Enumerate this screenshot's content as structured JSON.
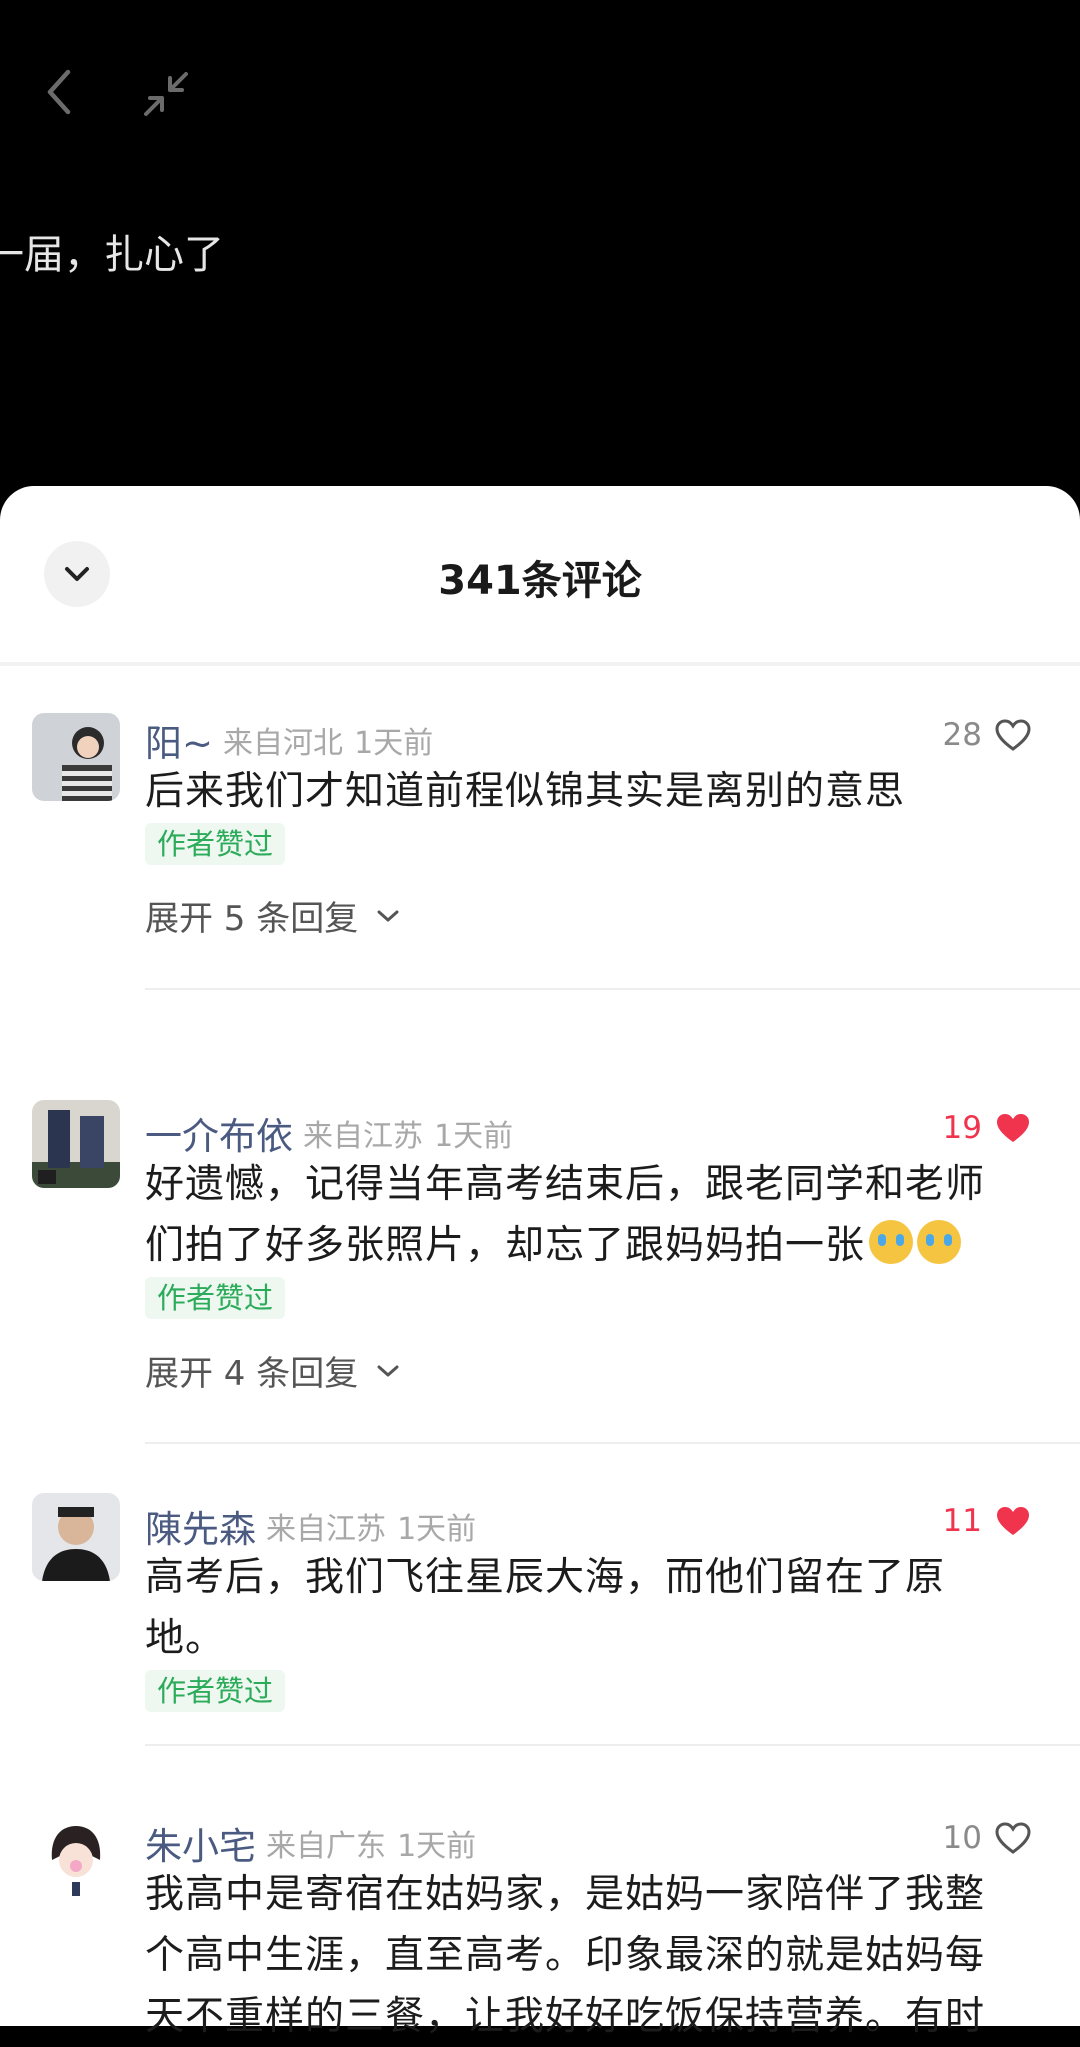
{
  "caption": "一届，扎心了",
  "header": {
    "title": "341条评论"
  },
  "colors": {
    "liked": "#f0344e",
    "author_badge": "#2cab5a",
    "username": "#4a5a80"
  },
  "comments": [
    {
      "user": "阳~",
      "location": "来自河北",
      "time": "1天前",
      "likes": "28",
      "liked": false,
      "lines": [
        "后来我们才知道前程似锦其实是离别的意思"
      ],
      "badge": "作者赞过",
      "replies": "展开 5 条回复"
    },
    {
      "user": "一介布依",
      "location": "来自江苏",
      "time": "1天前",
      "likes": "19",
      "liked": true,
      "lines": [
        "好遗憾，记得当年高考结束后，跟老同学和老师",
        "们拍了好多张照片，却忘了跟妈妈拍一张"
      ],
      "emoji": [
        "crying-face-emoji",
        "crying-face-emoji"
      ],
      "badge": "作者赞过",
      "replies": "展开 4 条回复"
    },
    {
      "user": "陳先森",
      "location": "来自江苏",
      "time": "1天前",
      "likes": "11",
      "liked": true,
      "lines": [
        "高考后，我们飞往星辰大海，而他们留在了原",
        "地。"
      ],
      "badge": "作者赞过"
    },
    {
      "user": "朱小宅",
      "location": "来自广东",
      "time": "1天前",
      "likes": "10",
      "liked": false,
      "lines": [
        "我高中是寄宿在姑妈家，是姑妈一家陪伴了我整",
        "个高中生涯，直至高考。印象最深的就是姑妈每",
        "天不重样的三餐，让我好好吃饭保持营养。有时"
      ]
    }
  ]
}
